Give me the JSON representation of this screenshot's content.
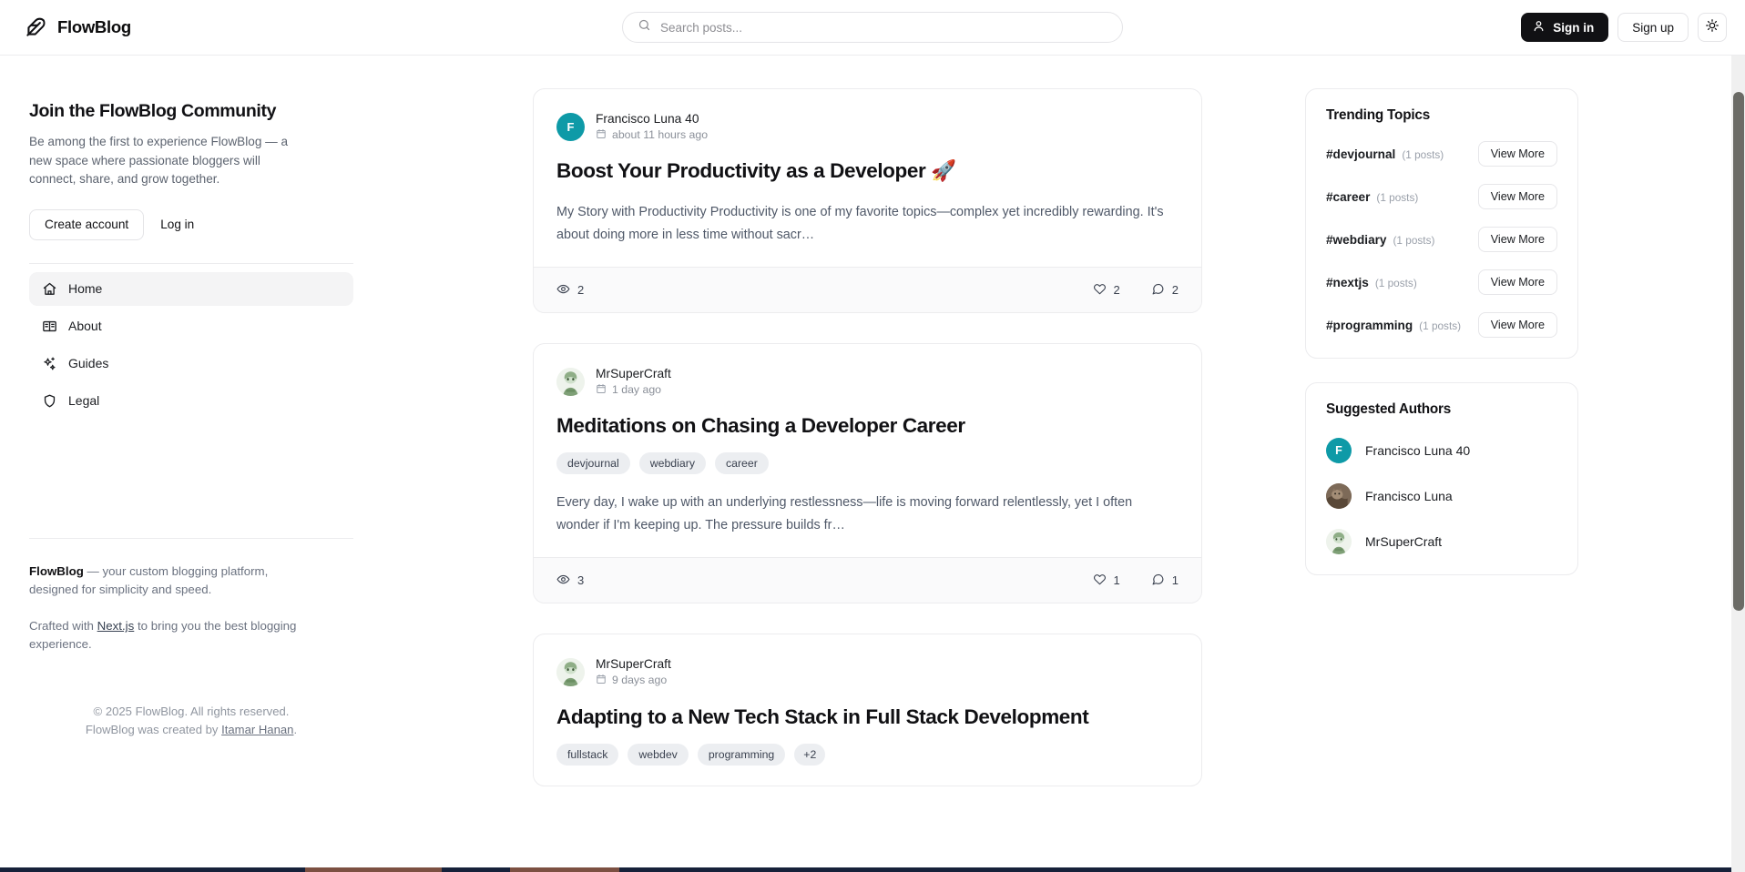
{
  "header": {
    "brand": "FlowBlog",
    "search_placeholder": "Search posts...",
    "sign_in_label": "Sign in",
    "sign_up_label": "Sign up"
  },
  "sidebar": {
    "cta_title": "Join the FlowBlog Community",
    "cta_text": "Be among the first to experience FlowBlog — a new space where passionate bloggers will connect, share, and grow together.",
    "create_account_label": "Create account",
    "log_in_label": "Log in",
    "nav": [
      {
        "label": "Home",
        "icon": "home-icon",
        "active": true
      },
      {
        "label": "About",
        "icon": "book-icon",
        "active": false
      },
      {
        "label": "Guides",
        "icon": "sparkles-icon",
        "active": false
      },
      {
        "label": "Legal",
        "icon": "shield-icon",
        "active": false
      }
    ],
    "footer": {
      "brand": "FlowBlog",
      "tagline": " — your custom blogging platform, designed for simplicity and speed.",
      "crafted_prefix": "Crafted with ",
      "crafted_link": "Next.js",
      "crafted_suffix": " to bring you the best blogging experience.",
      "copyright": "© 2025 FlowBlog. All rights reserved.",
      "created_prefix": "FlowBlog was created by ",
      "created_link": "Itamar Hanan",
      "created_suffix": "."
    }
  },
  "feed": {
    "posts": [
      {
        "author": "Francisco Luna 40",
        "avatar_kind": "initial",
        "avatar_initial": "F",
        "avatar_color": "#0e9aa7",
        "date": "about 11 hours ago",
        "title": "Boost Your Productivity as a Developer 🚀",
        "tags": [],
        "excerpt": "My Story with Productivity Productivity is one of my favorite topics—complex yet incredibly rewarding. It's about doing more in less time without sacr…",
        "views": "2",
        "likes": "2",
        "comments": "2"
      },
      {
        "author": "MrSuperCraft",
        "avatar_kind": "anime",
        "avatar_initial": "",
        "avatar_color": "#eef3ec",
        "date": "1 day ago",
        "title": "Meditations on Chasing a Developer Career",
        "tags": [
          "devjournal",
          "webdiary",
          "career"
        ],
        "excerpt": "Every day, I wake up with an underlying restlessness—life is moving forward relentlessly, yet I often wonder if I'm keeping up. The pressure builds fr…",
        "views": "3",
        "likes": "1",
        "comments": "1"
      },
      {
        "author": "MrSuperCraft",
        "avatar_kind": "anime",
        "avatar_initial": "",
        "avatar_color": "#eef3ec",
        "date": "9 days ago",
        "title": "Adapting to a New Tech Stack in Full Stack Development",
        "tags": [
          "fullstack",
          "webdev",
          "programming",
          "+2"
        ],
        "excerpt": "",
        "views": "",
        "likes": "",
        "comments": ""
      }
    ]
  },
  "rail": {
    "trending_title": "Trending Topics",
    "view_more_label": "View More",
    "topics": [
      {
        "tag": "#devjournal",
        "count": "(1 posts)"
      },
      {
        "tag": "#career",
        "count": "(1 posts)"
      },
      {
        "tag": "#webdiary",
        "count": "(1 posts)"
      },
      {
        "tag": "#nextjs",
        "count": "(1 posts)"
      },
      {
        "tag": "#programming",
        "count": "(1 posts)"
      }
    ],
    "authors_title": "Suggested Authors",
    "authors": [
      {
        "name": "Francisco Luna 40",
        "avatar_kind": "initial",
        "avatar_initial": "F",
        "avatar_color": "#0e9aa7"
      },
      {
        "name": "Francisco Luna",
        "avatar_kind": "cat",
        "avatar_initial": "",
        "avatar_color": "#8d7a66"
      },
      {
        "name": "MrSuperCraft",
        "avatar_kind": "anime",
        "avatar_initial": "",
        "avatar_color": "#eef3ec"
      }
    ]
  },
  "colors": {
    "accent_teal": "#0e9aa7",
    "dark_button": "#111114",
    "border": "#ececee",
    "muted_text": "#6b7280"
  }
}
